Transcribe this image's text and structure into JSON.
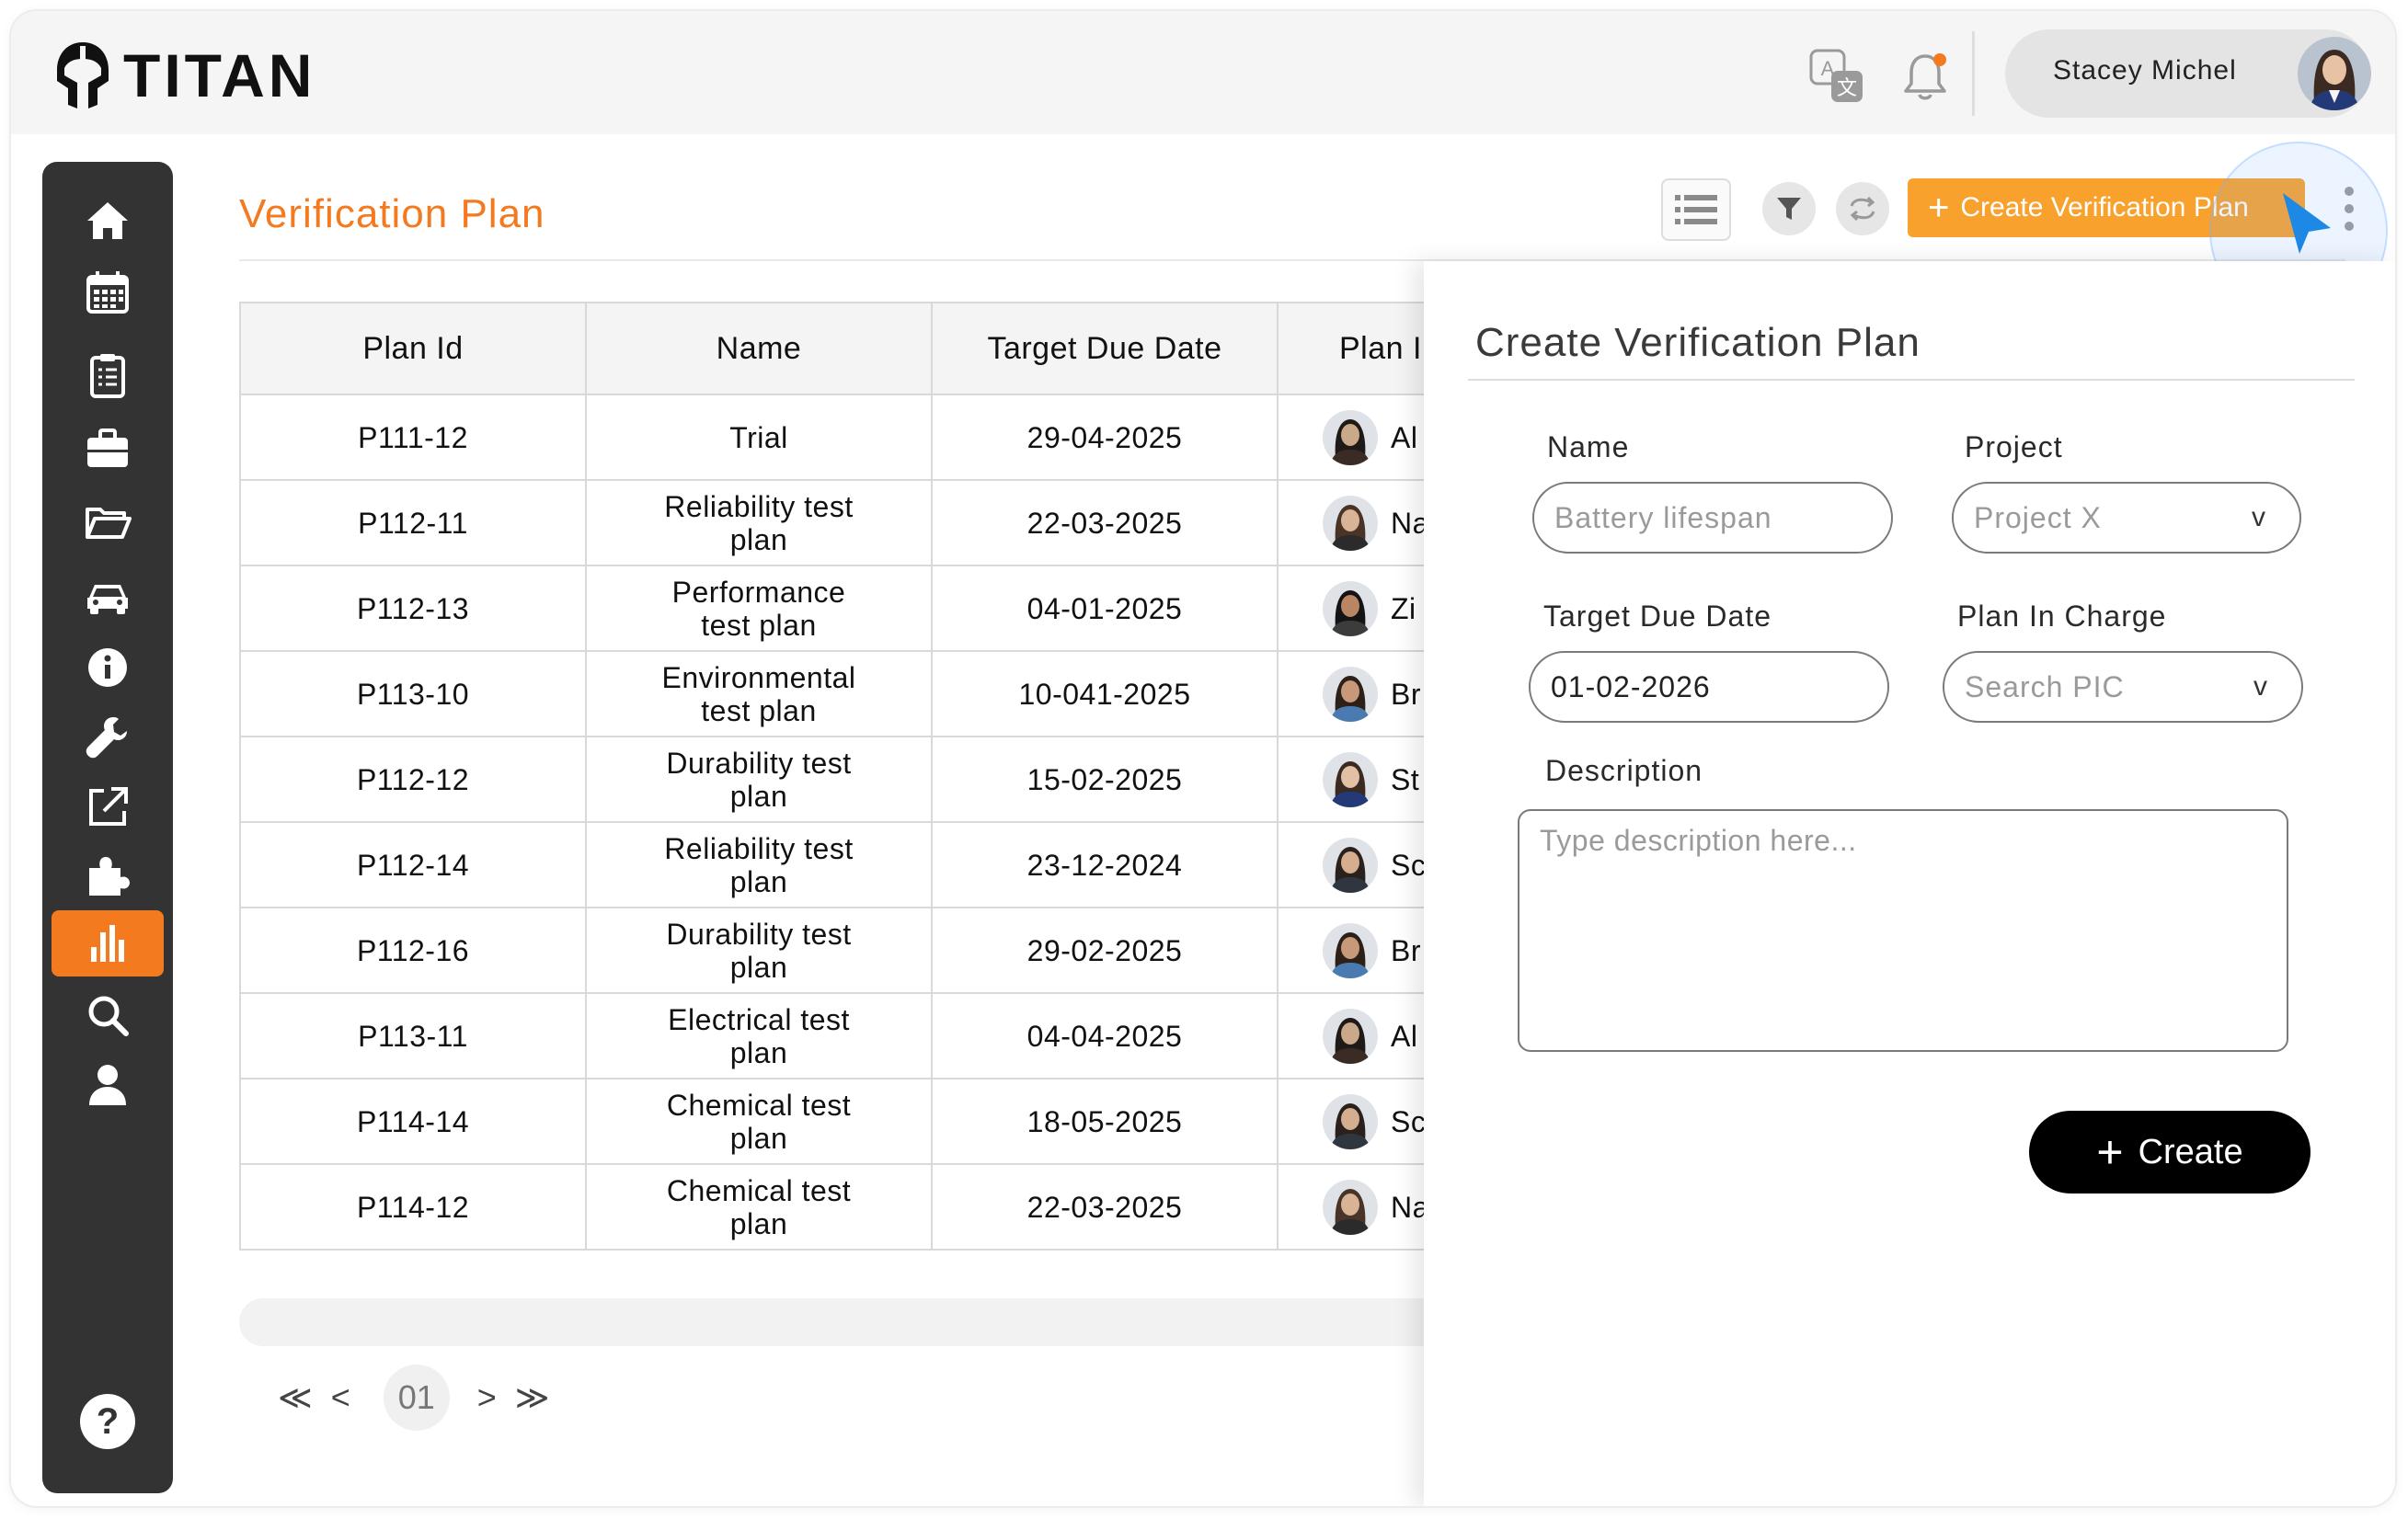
{
  "brand": {
    "name": "TITAN"
  },
  "header": {
    "user_name": "Stacey Michel",
    "icons": [
      "translate-icon",
      "bell-icon"
    ],
    "notification_dot_color": "#f47a20"
  },
  "sidebar": {
    "active_color": "#f47a20",
    "items": [
      {
        "icon": "home-icon",
        "active": false
      },
      {
        "icon": "calendar-icon",
        "active": false
      },
      {
        "icon": "clipboard-icon",
        "active": false
      },
      {
        "icon": "briefcase-icon",
        "active": false
      },
      {
        "icon": "folder-icon",
        "active": false
      },
      {
        "icon": "car-icon",
        "active": false
      },
      {
        "icon": "info-icon",
        "active": false
      },
      {
        "icon": "wrench-icon",
        "active": false
      },
      {
        "icon": "external-link-icon",
        "active": false
      },
      {
        "icon": "puzzle-icon",
        "active": false
      },
      {
        "icon": "bar-chart-icon",
        "active": true
      },
      {
        "icon": "search-icon",
        "active": false
      },
      {
        "icon": "user-icon",
        "active": false
      }
    ],
    "help_icon": "help-icon"
  },
  "main": {
    "page_title": "Verification Plan",
    "toolbar": {
      "create_label": "Create Verification Plan",
      "create_color": "#f8a12c",
      "icons": [
        "list-view-icon",
        "filter-icon",
        "refresh-icon",
        "more-vertical-icon"
      ]
    },
    "table": {
      "columns": [
        "Plan Id",
        "Name",
        "Target Due Date",
        "Plan In Charge"
      ],
      "rows": [
        {
          "id": "P111-12",
          "name": "Trial",
          "due": "29-04-2025",
          "pic": "Al"
        },
        {
          "id": "P112-11",
          "name": "Reliability test plan",
          "due": "22-03-2025",
          "pic": "Na"
        },
        {
          "id": "P112-13",
          "name": "Performance test plan",
          "due": "04-01-2025",
          "pic": "Zi"
        },
        {
          "id": "P113-10",
          "name": "Environmental test plan",
          "due": "10-041-2025",
          "pic": "Br"
        },
        {
          "id": "P112-12",
          "name": "Durability test plan",
          "due": "15-02-2025",
          "pic": "St"
        },
        {
          "id": "P112-14",
          "name": "Reliability test plan",
          "due": "23-12-2024",
          "pic": "Sc"
        },
        {
          "id": "P112-16",
          "name": "Durability test plan",
          "due": "29-02-2025",
          "pic": "Br"
        },
        {
          "id": "P113-11",
          "name": "Electrical test plan",
          "due": "04-04-2025",
          "pic": "Al"
        },
        {
          "id": "P114-14",
          "name": "Chemical test plan",
          "due": "18-05-2025",
          "pic": "Sc"
        },
        {
          "id": "P114-12",
          "name": "Chemical test plan",
          "due": "22-03-2025",
          "pic": "Na"
        }
      ]
    },
    "pagination": {
      "first": "≪",
      "prev": "<",
      "current": "01",
      "next": ">",
      "last": "≫"
    }
  },
  "drawer": {
    "title": "Create Verification Plan",
    "name_label": "Name",
    "name_placeholder": "Battery lifespan",
    "project_label": "Project",
    "project_value": "Project X",
    "due_label": "Target Due Date",
    "due_value": "01-02-2026",
    "pic_label": "Plan In Charge",
    "pic_placeholder": "Search PIC",
    "desc_label": "Description",
    "desc_placeholder": "Type description here...",
    "chevron": "v",
    "create_label": "Create"
  }
}
